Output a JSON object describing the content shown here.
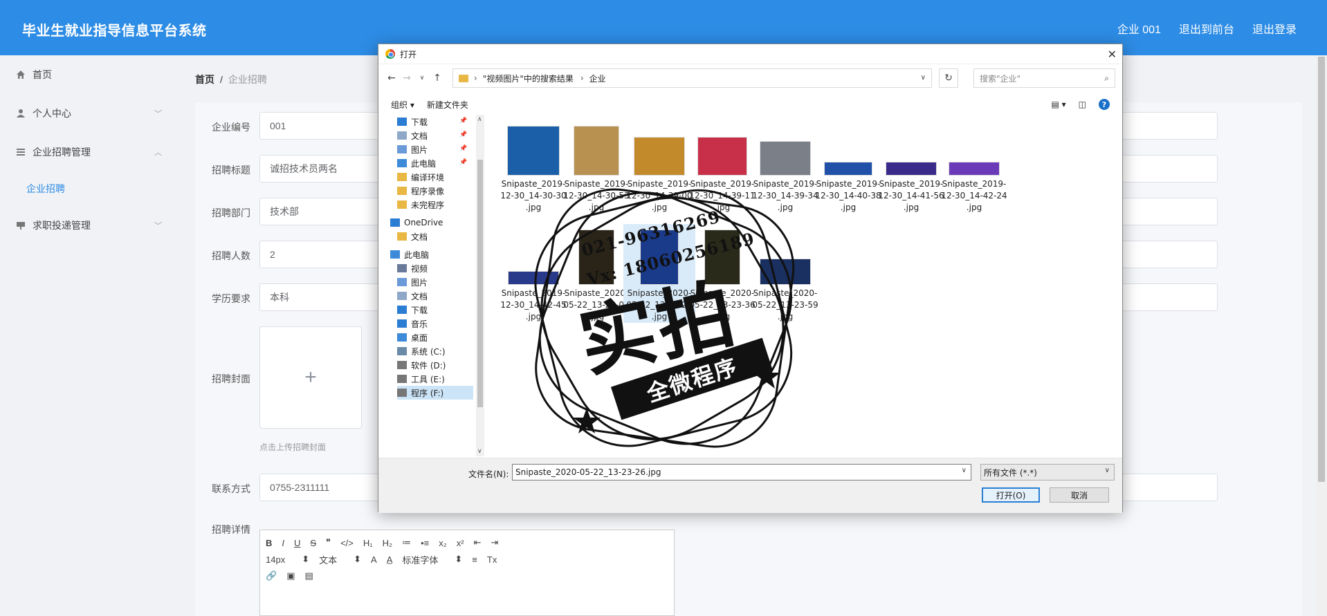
{
  "header": {
    "title": "毕业生就业指导信息平台系统",
    "nav": [
      "企业 001",
      "退出到前台",
      "退出登录"
    ]
  },
  "sidebar": {
    "items": [
      {
        "label": "首页",
        "icon": "home-icon"
      },
      {
        "label": "个人中心",
        "icon": "user-icon"
      },
      {
        "label": "企业招聘管理",
        "icon": "menu-icon"
      },
      {
        "label": "求职投递管理",
        "icon": "post-icon"
      }
    ],
    "sub_item": "企业招聘"
  },
  "breadcrumb": {
    "home": "首页",
    "sep": "/",
    "current": "企业招聘"
  },
  "form": {
    "fields": [
      {
        "label": "企业编号",
        "value": "001"
      },
      {
        "label": "招聘标题",
        "value": "诚招技术员两名"
      },
      {
        "label": "招聘部门",
        "value": "技术部"
      },
      {
        "label": "招聘人数",
        "value": "2"
      },
      {
        "label": "学历要求",
        "value": "本科"
      }
    ],
    "cover_label": "招聘封面",
    "cover_hint": "点击上传招聘封面",
    "contact_label": "联系方式",
    "contact_value": "0755-2311111",
    "detail_label": "招聘详情",
    "editor": {
      "row1": [
        "B",
        "I",
        "U",
        "S",
        "❞",
        "</>",
        "H₁",
        "H₂",
        "≔",
        "•≡",
        "x₂",
        "x²",
        "⇤",
        "⇥"
      ],
      "font_size": "14px",
      "text_style": "文本",
      "font_family": "标准字体",
      "row2_icons": [
        "A",
        "A̲",
        "≡",
        "Tx"
      ],
      "row3_icons": [
        "🔗",
        "▣",
        "▤"
      ]
    }
  },
  "dialog": {
    "title": "打开",
    "path": [
      "\"视频图片\"中的搜索结果",
      "企业"
    ],
    "search_placeholder": "搜索\"企业\"",
    "toolbar": {
      "organize": "组织 ▾",
      "new_folder": "新建文件夹"
    },
    "tree": [
      {
        "label": "下载",
        "color": "#2b7cd3",
        "pinned": true
      },
      {
        "label": "文档",
        "color": "#8fa8c8",
        "pinned": true
      },
      {
        "label": "图片",
        "color": "#6a9ad8",
        "pinned": true
      },
      {
        "label": "此电脑",
        "color": "#3c8ad8",
        "pinned": true
      },
      {
        "label": "编译环境",
        "color": "#e8b744",
        "pinned": false
      },
      {
        "label": "程序录像",
        "color": "#e8b744",
        "pinned": false
      },
      {
        "label": "未完程序",
        "color": "#e8b744",
        "pinned": false
      },
      {
        "label": "OneDrive",
        "color": "#2b7cd3",
        "pinned": false
      },
      {
        "label": "文档",
        "color": "#e8b744",
        "pinned": false
      },
      {
        "label": "此电脑",
        "color": "#3c8ad8",
        "pinned": false
      },
      {
        "label": "视频",
        "color": "#6a7a9a",
        "pinned": false
      },
      {
        "label": "图片",
        "color": "#6a9ad8",
        "pinned": false
      },
      {
        "label": "文档",
        "color": "#8fa8c8",
        "pinned": false
      },
      {
        "label": "下载",
        "color": "#2b7cd3",
        "pinned": false
      },
      {
        "label": "音乐",
        "color": "#2b7cd3",
        "pinned": false
      },
      {
        "label": "桌面",
        "color": "#3c8ad8",
        "pinned": false
      },
      {
        "label": "系统 (C:)",
        "color": "#6a8aa8",
        "pinned": false
      },
      {
        "label": "软件 (D:)",
        "color": "#777777",
        "pinned": false
      },
      {
        "label": "工具 (E:)",
        "color": "#777777",
        "pinned": false
      },
      {
        "label": "程序 (F:)",
        "color": "#777777",
        "pinned": false
      }
    ],
    "files": [
      {
        "name": "Snipaste_2019-12-30_14-30-30.jpg",
        "l1": "Snipaste_2019-",
        "l2": "12-30_14-30-30",
        "l3": ".jpg",
        "color": "#1a5fa8"
      },
      {
        "name": "Snipaste_2019-12-30_14-30-53.jpg",
        "l1": "Snipaste_2019-",
        "l2": "12-30_14-30-53",
        "l3": ".jpg",
        "color": "#b89050"
      },
      {
        "name": "Snipaste_2019-12-30_14-39-00.jpg",
        "l1": "Snipaste_2019-",
        "l2": "12-30_14-39-00",
        "l3": ".jpg",
        "color": "#c28a2a"
      },
      {
        "name": "Snipaste_2019-12-30_14-39-11.jpg",
        "l1": "Snipaste_2019-",
        "l2": "12-30_14-39-11",
        "l3": ".jpg",
        "color": "#c8304a"
      },
      {
        "name": "Snipaste_2019-12-30_14-39-34.jpg",
        "l1": "Snipaste_2019-",
        "l2": "12-30_14-39-34",
        "l3": ".jpg",
        "color": "#7a7f88"
      },
      {
        "name": "Snipaste_2019-12-30_14-40-38.jpg",
        "l1": "Snipaste_2019-",
        "l2": "12-30_14-40-38",
        "l3": ".jpg",
        "color": "#2050a8"
      },
      {
        "name": "Snipaste_2019-12-30_14-41-56.jpg",
        "l1": "Snipaste_2019-",
        "l2": "12-30_14-41-56",
        "l3": ".jpg",
        "color": "#3a2a8a"
      },
      {
        "name": "Snipaste_2019-12-30_14-42-24.jpg",
        "l1": "Snipaste_2019-",
        "l2": "12-30_14-42-24",
        "l3": ".jpg",
        "color": "#6a3ab8"
      },
      {
        "name": "Snipaste_2019-12-30_14-42-45.jpg",
        "l1": "Snipaste_2019-",
        "l2": "12-30_14-42-45",
        "l3": ".jpg",
        "color": "#2a3a8a"
      },
      {
        "name": "Snipaste_2020-05-22_13-23-07.jpg",
        "l1": "Snipaste_2020-",
        "l2": "05-22_13-23-07",
        "l3": ".jpg",
        "color": "#2a2418"
      },
      {
        "name": "Snipaste_2020-05-22_13-23-26.jpg",
        "l1": "Snipaste_2020-",
        "l2": "05-22_13-23-26",
        "l3": ".jpg",
        "color": "#1a3a8a"
      },
      {
        "name": "Snipaste_2020-05-22_13-23-36.jpg",
        "l1": "Snipaste_2020-",
        "l2": "05-22_13-23-36",
        "l3": ".jpg",
        "color": "#2a2a1a"
      },
      {
        "name": "Snipaste_2020-05-22_13-23-59.jpg",
        "l1": "Snipaste_2020-",
        "l2": "05-22_13-23-59",
        "l3": ".jpg",
        "color": "#1a3060"
      }
    ],
    "filename_label": "文件名(N):",
    "filename_value": "Snipaste_2020-05-22_13-23-26.jpg",
    "filetype": "所有文件 (*.*)",
    "open_btn": "打开(O)",
    "cancel_btn": "取消"
  },
  "watermark": {
    "phone": "021-96316269",
    "vx": "Vx: 18060256189",
    "big": "实拍",
    "ribbon": "全微程序"
  }
}
